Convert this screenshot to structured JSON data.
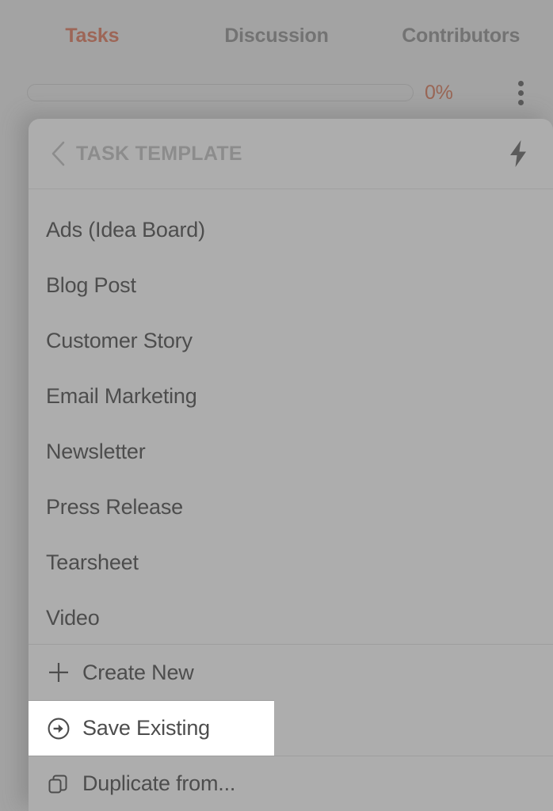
{
  "app": {
    "tabs": [
      {
        "label": "Tasks",
        "active": true
      },
      {
        "label": "Discussion",
        "active": false
      },
      {
        "label": "Contributors",
        "active": false
      }
    ],
    "progress": {
      "percent_label": "0%",
      "percent_value": 0,
      "accent_color": "#a35c45"
    },
    "overflow_menu": {
      "icon": "kebab-menu-icon"
    }
  },
  "sheet": {
    "back_icon": "chevron-left-icon",
    "title": "TASK TEMPLATE",
    "action_icon": "lightning-bolt-icon",
    "templates": [
      {
        "label": "Ads (Idea Board)"
      },
      {
        "label": "Blog Post"
      },
      {
        "label": "Customer Story"
      },
      {
        "label": "Email Marketing"
      },
      {
        "label": "Newsletter"
      },
      {
        "label": "Press Release"
      },
      {
        "label": "Tearsheet"
      },
      {
        "label": "Video"
      }
    ],
    "actions": [
      {
        "label": "Create New",
        "icon": "plus-icon",
        "highlighted": false
      },
      {
        "label": "Save Existing",
        "icon": "circle-arrow-right-icon",
        "highlighted": true
      },
      {
        "label": "Duplicate from...",
        "icon": "duplicate-icon",
        "highlighted": false
      }
    ]
  },
  "colors": {
    "background": "#b0b0b0",
    "sheet": "#adadad",
    "accent": "#a85c47",
    "text": "#4d4d4d",
    "muted_text": "#8c8c8c",
    "highlight": "#ffffff"
  }
}
